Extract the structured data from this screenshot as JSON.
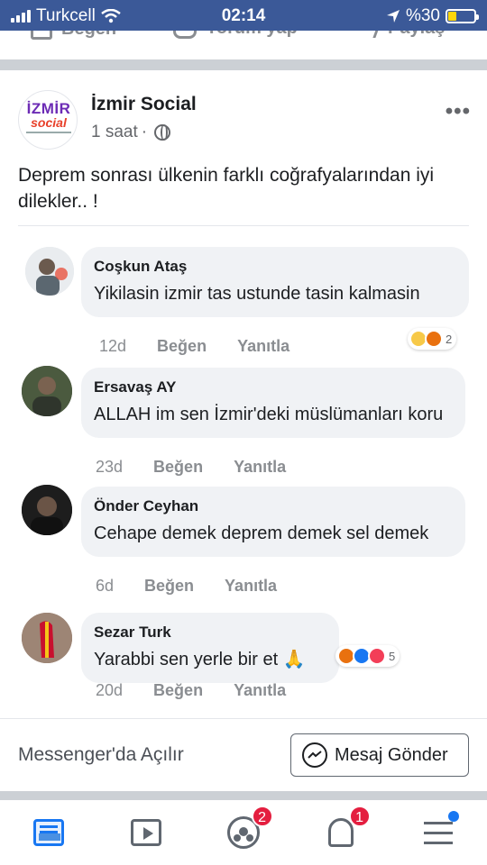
{
  "status_bar": {
    "carrier": "Turkcell",
    "time": "02:14",
    "battery": "%30",
    "battery_level": 0.3
  },
  "action_bar": {
    "like": "Beğen",
    "comment": "Yorum yap",
    "share": "Paylaş"
  },
  "post": {
    "page_name": "İzmir Social",
    "logo_text_1": "İZMİR",
    "logo_text_2": "social",
    "time": "1 saat",
    "separator": "·",
    "text": "Deprem sonrası ülkenin farklı coğrafyalarından iyi dilekler.. !"
  },
  "comments": [
    {
      "name": "Coşkun Ataş",
      "text": "Yikilasin izmir tas ustunde tasin kalmasin",
      "age": "12d",
      "like": "Beğen",
      "reply": "Yanıtla",
      "reactions": [
        "wow",
        "angry"
      ],
      "reaction_count": "2"
    },
    {
      "name": "Ersavaş AY",
      "text": "ALLAH im sen İzmir'deki müslümanları koru",
      "age": "23d",
      "like": "Beğen",
      "reply": "Yanıtla"
    },
    {
      "name": "Önder Ceyhan",
      "text": "Cehape demek deprem demek sel demek",
      "age": "6d",
      "like": "Beğen",
      "reply": "Yanıtla"
    },
    {
      "name": "Sezar Turk",
      "text": "Yarabbi sen yerle bir et 🙏",
      "age": "20d",
      "like": "Beğen",
      "reply": "Yanıtla",
      "reactions": [
        "angry",
        "like",
        "love"
      ],
      "reaction_count": "5"
    }
  ],
  "messenger": {
    "open_label": "Messenger'da Açılır",
    "send_label": "Mesaj Gönder"
  },
  "nav": {
    "groups_badge": "2",
    "notifications_badge": "1"
  },
  "colors": {
    "brand": "#3b5998",
    "bubble": "#f0f2f5",
    "badge": "#e41e3f"
  }
}
